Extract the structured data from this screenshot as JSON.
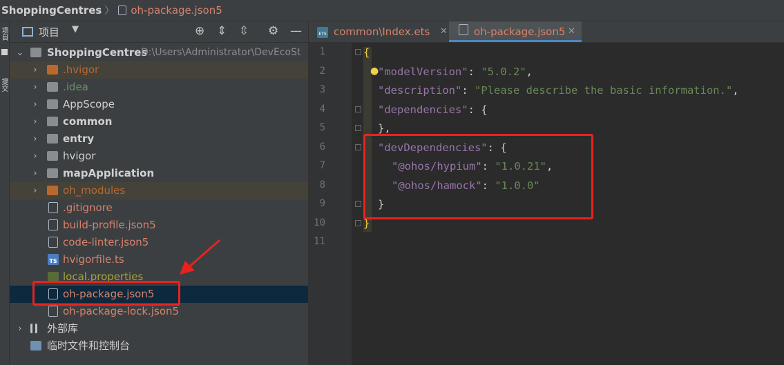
{
  "breadcrumb": {
    "root": "ShoppingCentres",
    "file": "oh-package.json5"
  },
  "left_strip": {
    "project_tab": "项目",
    "commit_tab": "提交"
  },
  "project_panel": {
    "title": "项目"
  },
  "tree": {
    "root": {
      "label": "ShoppingCentres",
      "path": "D:\\Users\\Administrator\\DevEcoSt"
    },
    "items": [
      {
        "label": ".hvigor"
      },
      {
        "label": ".idea"
      },
      {
        "label": "AppScope"
      },
      {
        "label": "common"
      },
      {
        "label": "entry"
      },
      {
        "label": "hvigor"
      },
      {
        "label": "mapApplication"
      },
      {
        "label": "oh_modules"
      },
      {
        "label": ".gitignore"
      },
      {
        "label": "build-profile.json5"
      },
      {
        "label": "code-linter.json5"
      },
      {
        "label": "hvigorfile.ts"
      },
      {
        "label": "local.properties"
      },
      {
        "label": "oh-package.json5"
      },
      {
        "label": "oh-package-lock.json5"
      }
    ],
    "external_libs": "外部库",
    "scratches": "临时文件和控制台"
  },
  "tabs": [
    {
      "label": "common\\Index.ets",
      "icon_text": "ETS"
    },
    {
      "label": "oh-package.json5"
    }
  ],
  "colors": {
    "accent": "#4a88c7",
    "annotation": "#e8231f",
    "vcs_modified": "#d7826b"
  },
  "code": {
    "line_numbers": [
      "1",
      "2",
      "3",
      "4",
      "5",
      "6",
      "7",
      "8",
      "9",
      "10",
      "11"
    ],
    "l1_open": "{",
    "l2_key": "\"modelVersion\"",
    "l2_sep": ": ",
    "l2_val": "\"5.0.2\"",
    "l2_end": ",",
    "l3_key": "\"description\"",
    "l3_sep": ": ",
    "l3_val": "\"Please describe the basic information.\"",
    "l3_end": ",",
    "l4_key": "\"dependencies\"",
    "l4_sep": ": {",
    "l5": "},",
    "l6_key": "\"devDependencies\"",
    "l6_sep": ": {",
    "l7_key": "\"@ohos/hypium\"",
    "l7_sep": ": ",
    "l7_val": "\"1.0.21\"",
    "l7_end": ",",
    "l8_key": "\"@ohos/hamock\"",
    "l8_sep": ": ",
    "l8_val": "\"1.0.0\"",
    "l9": "}",
    "l10_close": "}"
  }
}
